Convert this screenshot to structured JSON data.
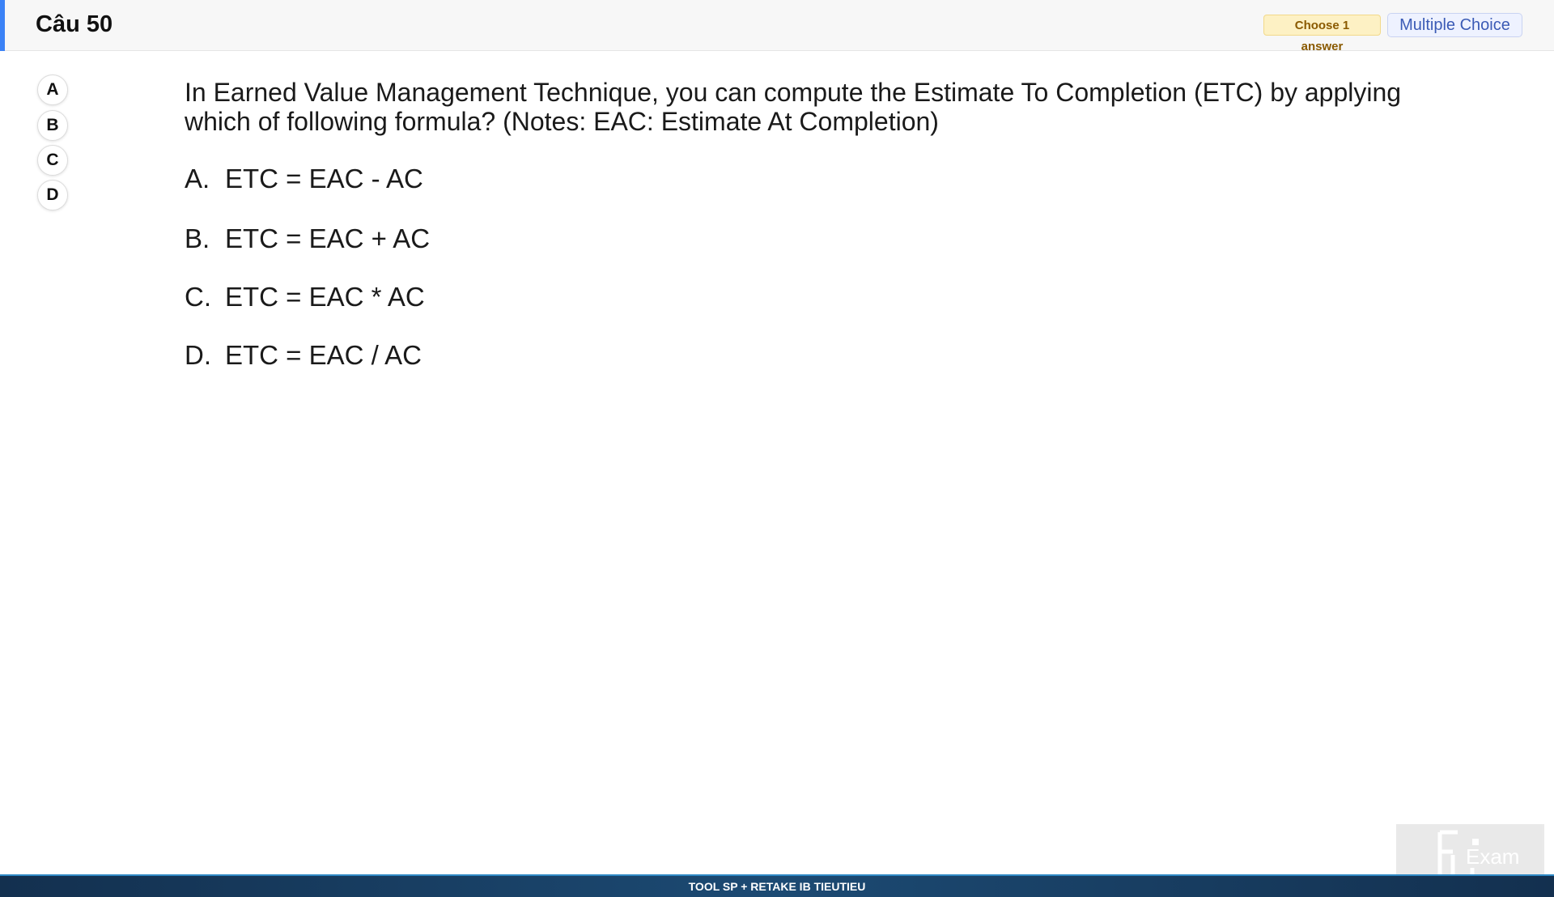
{
  "header": {
    "title": "Câu 50",
    "choose_badge": "Choose 1 answer",
    "type_badge": "Multiple Choice"
  },
  "answer_buttons": [
    "A",
    "B",
    "C",
    "D"
  ],
  "question": {
    "text": "In Earned Value Management Technique, you can compute the Estimate To Completion (ETC) by applying which of following formula? (Notes: EAC: Estimate At Completion)",
    "options": [
      {
        "letter": "A.",
        "text": "ETC = EAC - AC"
      },
      {
        "letter": "B.",
        "text": "ETC = EAC + AC"
      },
      {
        "letter": "C.",
        "text": "ETC = EAC * AC"
      },
      {
        "letter": "D.",
        "text": "ETC = EAC / AC"
      }
    ]
  },
  "footer": {
    "text": "TOOL SP + RETAKE IB TIEUTIEU"
  },
  "watermark": {
    "text": "Exam"
  },
  "colors": {
    "accent": "#3b82f6",
    "choose_badge_bg": "#fdf1c4",
    "type_badge_text": "#3b5bb5",
    "footer_bg": "#13304f"
  }
}
